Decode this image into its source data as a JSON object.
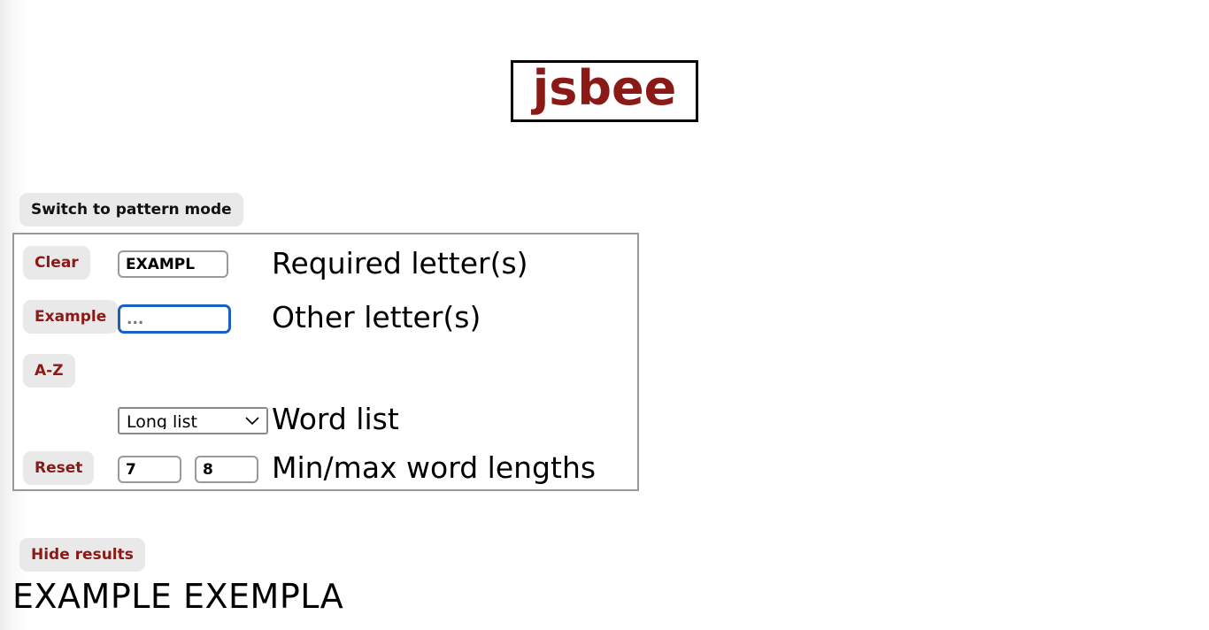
{
  "app": {
    "title": "jsbee",
    "brand_color": "#8b1a16"
  },
  "mode_toggle": {
    "label": "Switch to pattern mode"
  },
  "form": {
    "rows": [
      {
        "button": "Clear",
        "input_value": "EXAMPL",
        "input_placeholder": "",
        "label": "Required letter(s)"
      },
      {
        "button": "Example",
        "input_value": "",
        "input_placeholder": "...",
        "label": "Other letter(s)"
      },
      {
        "button": "A-Z",
        "label": ""
      }
    ],
    "word_list": {
      "label": "Word list",
      "selected": "Long list",
      "options": [
        "Long list"
      ]
    },
    "lengths": {
      "button": "Reset",
      "label": "Min/max word lengths",
      "min": "7",
      "max": "8"
    }
  },
  "results": {
    "toggle_label": "Hide results",
    "words": "EXAMPLE EXEMPLA"
  },
  "icons": {
    "chevron_down": "chevron-down-icon"
  }
}
